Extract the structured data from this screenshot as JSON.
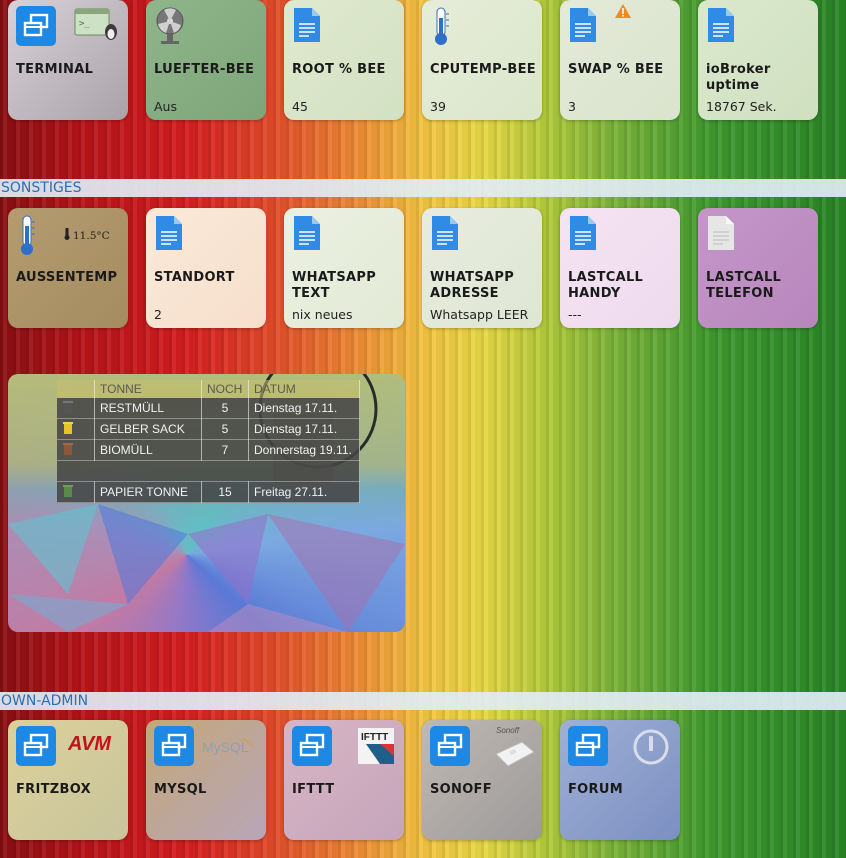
{
  "row1": [
    {
      "title": "TERMINAL",
      "value": ""
    },
    {
      "title": "LUEFTER-BEE",
      "value": "Aus"
    },
    {
      "title": "ROOT % BEE",
      "value": "45"
    },
    {
      "title": "CPUTEMP-BEE",
      "value": "39"
    },
    {
      "title": "SWAP % BEE",
      "value": "3"
    },
    {
      "title": "ioBroker uptime",
      "value": "18767 Sek."
    }
  ],
  "sections": {
    "sonstiges": "SONSTIGES",
    "own_admin": "OWN-ADMIN"
  },
  "row2": [
    {
      "title": "AUSSENTEMP",
      "value": "",
      "badge": "11.5°C"
    },
    {
      "title": "STANDORT",
      "value": "2"
    },
    {
      "title": "WHATSAPP TEXT",
      "value": "nix neues"
    },
    {
      "title": "WHATSAPP ADRESSE",
      "value": "Whatsapp LEER"
    },
    {
      "title": "LASTCALL HANDY",
      "value": "---"
    },
    {
      "title": "LASTCALL TELEFON",
      "value": ""
    }
  ],
  "waste_table": {
    "headers": [
      "TONNE",
      "NOCH",
      "DATUM"
    ],
    "rows": [
      {
        "name": "RESTMÜLL",
        "days": "5",
        "date": "Dienstag 17.11."
      },
      {
        "name": "GELBER SACK",
        "days": "5",
        "date": "Dienstag 17.11."
      },
      {
        "name": "BIOMÜLL",
        "days": "7",
        "date": "Donnerstag 19.11."
      },
      {
        "name": "PAPIER TONNE",
        "days": "15",
        "date": "Freitag 27.11."
      }
    ]
  },
  "row3": [
    {
      "title": "FRITZBOX",
      "logo": "AVM"
    },
    {
      "title": "MYSQL",
      "logo": "MySQL"
    },
    {
      "title": "IFTTT",
      "logo": "IFTTT"
    },
    {
      "title": "SONOFF",
      "logo": "Sonoff"
    },
    {
      "title": "FORUM",
      "logo": "power-icon"
    }
  ],
  "colors": {
    "link_blue": "#1e88e5",
    "doc_blue": "#2f8be6",
    "section_text": "#2a6fb3"
  }
}
